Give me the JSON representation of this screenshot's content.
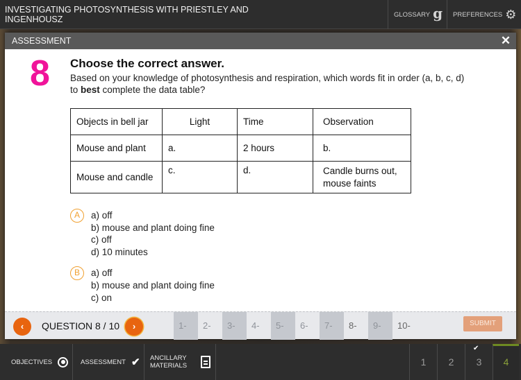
{
  "header": {
    "course_title": "INVESTIGATING PHOTOSYNTHESIS WITH PRIESTLEY AND INGENHOUSZ",
    "glossary_label": "GLOSSARY",
    "glossary_icon": "g",
    "preferences_label": "PREFERENCES",
    "preferences_icon": "⚙"
  },
  "modal": {
    "title": "ASSESSMENT",
    "close_icon": "✕",
    "question_number": "8",
    "question_title": "Choose the correct answer.",
    "question_text_pre": "Based on your knowledge of photosynthesis and respiration, which words fit in order (a, b, c, d) to ",
    "question_text_bold": "best",
    "question_text_post": " complete the data table?",
    "table": {
      "headers": [
        "Objects in bell jar",
        "Light",
        "Time",
        "Observation"
      ],
      "rows": [
        [
          "Mouse and plant",
          "a.",
          "2 hours",
          "b."
        ],
        [
          "Mouse and candle",
          "c.",
          "d.",
          "Candle burns out, mouse faints"
        ]
      ]
    },
    "options": [
      {
        "letter": "A",
        "lines": [
          "a) off",
          "b) mouse and plant doing fine",
          "c) off",
          "d) 10 minutes"
        ]
      },
      {
        "letter": "B",
        "lines": [
          "a) off",
          "b) mouse and plant doing fine",
          "c) on"
        ]
      }
    ],
    "accent_color": "#f0149a",
    "option_color": "#f0a030"
  },
  "question_nav": {
    "prev_icon": "‹",
    "next_icon": "›",
    "label": "QUESTION 8 / 10",
    "tiles": [
      "1-",
      "2-",
      "3-",
      "4-",
      "5-",
      "6-",
      "7-",
      "8-",
      "9-",
      "10-"
    ],
    "submit_label": "SUBMIT",
    "nav_color": "#e8640f"
  },
  "bottombar": {
    "objectives_label": "OBJECTIVES",
    "assessment_label": "ASSESSMENT",
    "ancillary_label_1": "ANCILLARY",
    "ancillary_label_2": "MATERIALS",
    "check_icon": "✔",
    "pages": [
      "1",
      "2",
      "3",
      "4"
    ],
    "completed_page_mark": "✔",
    "current_page": "4"
  }
}
